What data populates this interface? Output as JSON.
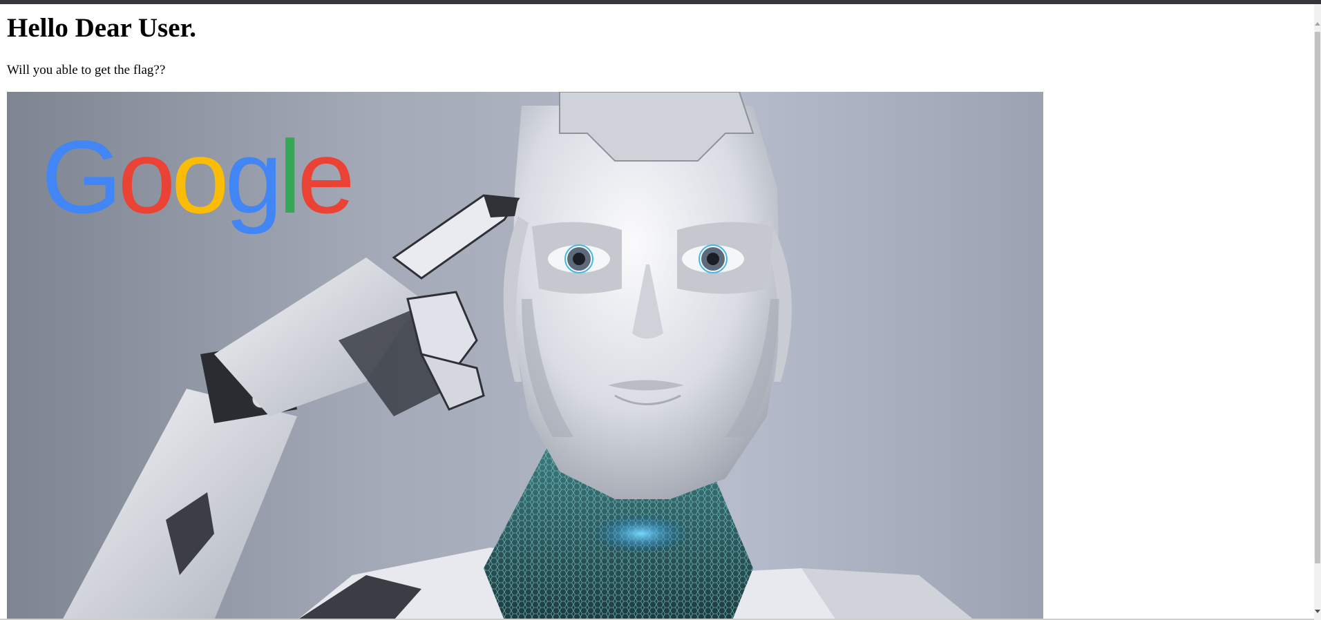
{
  "page": {
    "heading": "Hello Dear User.",
    "subtitle": "Will you able to get the flag??"
  },
  "hero_image": {
    "logo_text": "Google",
    "logo_colors": [
      "#4285F4",
      "#EA4335",
      "#FBBC05",
      "#4285F4",
      "#34A853",
      "#EA4335"
    ]
  }
}
